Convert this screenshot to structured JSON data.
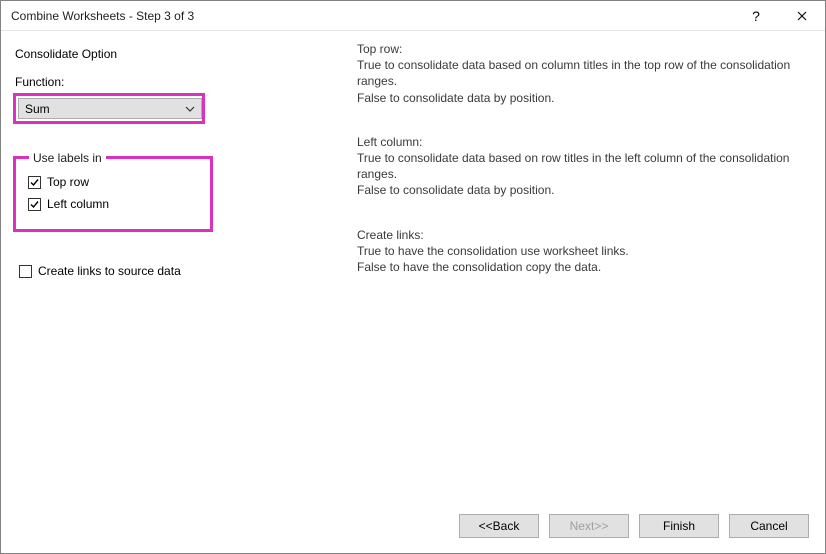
{
  "window": {
    "title": "Combine Worksheets - Step 3 of 3"
  },
  "left": {
    "section_title": "Consolidate Option",
    "function_label": "Function:",
    "function_value": "Sum",
    "labels_legend": "Use labels in",
    "check_top_row": "Top row",
    "check_left_col": "Left column",
    "check_links": "Create links to source data"
  },
  "help": {
    "top_row_h": "Top row:",
    "top_row_1": "True to consolidate data based on column titles in the top row of the consolidation ranges.",
    "top_row_2": "False to consolidate data by position.",
    "left_col_h": "Left column:",
    "left_col_1": "True to consolidate data based on row titles in the left column of the consolidation ranges.",
    "left_col_2": "False to consolidate data by position.",
    "links_h": "Create links:",
    "links_1": "True to have the consolidation use worksheet links.",
    "links_2": "False to have the consolidation copy the data."
  },
  "buttons": {
    "back": "<<Back",
    "next": "Next>>",
    "finish": "Finish",
    "cancel": "Cancel"
  }
}
